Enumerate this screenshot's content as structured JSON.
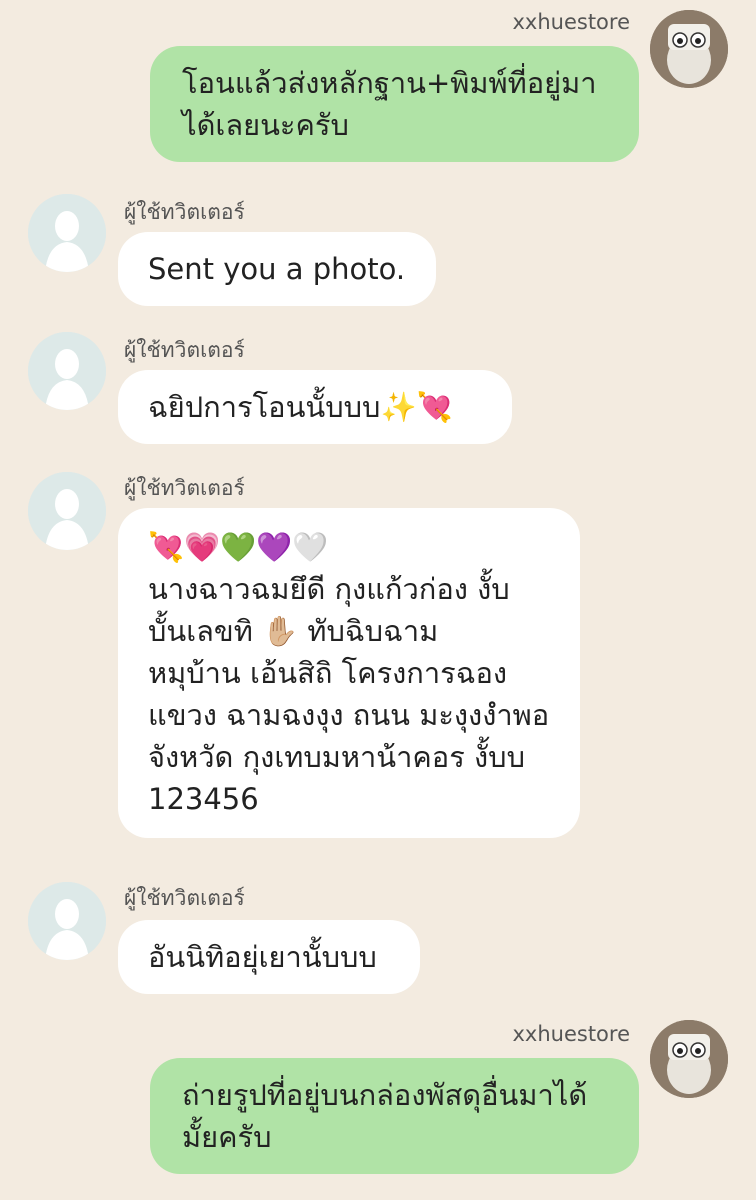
{
  "store_name": "xxhuestore",
  "user_name": "ผู้ใช้ทวิตเตอร์",
  "messages": [
    {
      "lines": [
        "โอนแล้วส่งหลักฐาน+พิมพ์ที่อยู่มา",
        "ได้เลยนะครับ"
      ]
    },
    {
      "lines": [
        "Sent you a photo."
      ]
    },
    {
      "lines": [
        "ฉยิปการโอนนั้บบบ✨💘"
      ]
    },
    {
      "lines": [
        "💘💗💚💜🤍",
        "นางฉาวฉมยึดี กุงแก้วก่อง งั้บ",
        "บั้นเลขทิ ✋🏼 ทับฉิบฉาม",
        "หมุบ้าน เอ้นสิถิ โครงการฉอง",
        "แขวง ฉามฉงงุง ถนน มะงุงงำพอ",
        "จังหวัด กุงเทบมหาน้าคอร งั้บบ",
        "123456"
      ]
    },
    {
      "lines": [
        "อันนิทิอยุ่เยานั้บบบ"
      ]
    },
    {
      "lines": [
        "ถ่ายรูปที่อยู่บนกล่องพัสดุอื่นมาได้",
        "มั้ยครับ"
      ]
    }
  ]
}
